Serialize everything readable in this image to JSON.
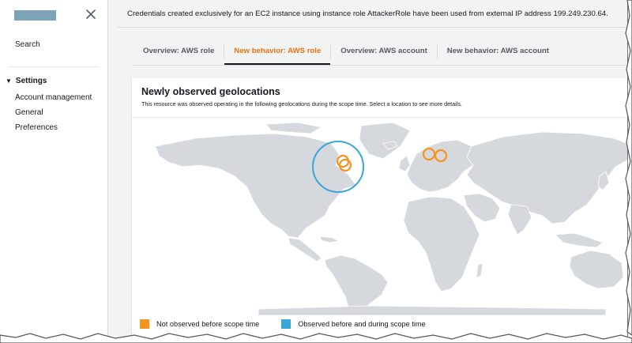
{
  "sidebar": {
    "close_label": "×",
    "search": "Search",
    "settings_header": "Settings",
    "items": [
      {
        "label": "Account management"
      },
      {
        "label": "General"
      },
      {
        "label": "Preferences"
      }
    ]
  },
  "banner": {
    "text": "Credentials created exclusively for an EC2 instance using instance role AttackerRole have been used from external IP address 199.249.230.64."
  },
  "tabs": [
    {
      "label": "Overview: AWS role",
      "active": false
    },
    {
      "label": "New behavior: AWS role",
      "active": true
    },
    {
      "label": "Overview: AWS account",
      "active": false
    },
    {
      "label": "New behavior: AWS account",
      "active": false
    }
  ],
  "panel": {
    "title": "Newly observed geolocations",
    "description": "This resource was observed operating in the following geolocations during the scope time. Select a location to see more details."
  },
  "legend": {
    "not_observed": "Not observed before scope time",
    "observed": "Observed before and during scope time"
  },
  "colors": {
    "accent_orange": "#ec7211",
    "marker_orange": "#f7931e",
    "marker_blue": "#3aa7d8",
    "land": "#d5d8dc",
    "text": "#16191f"
  }
}
